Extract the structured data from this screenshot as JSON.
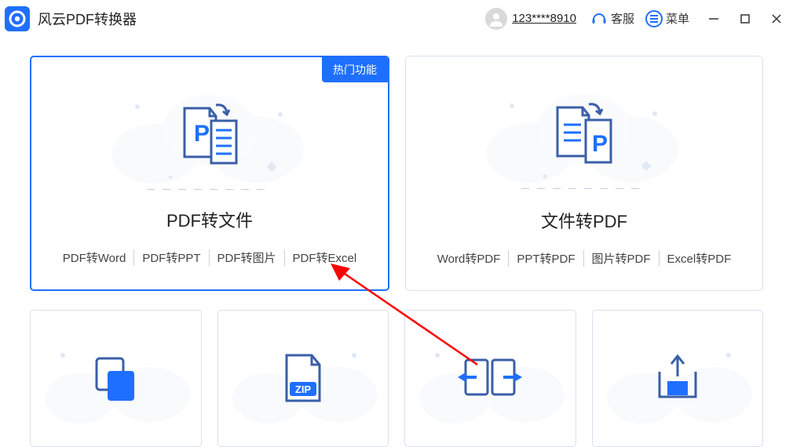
{
  "app": {
    "title": "风云PDF转换器"
  },
  "header": {
    "user_id": "123****8910",
    "service_label": "客服",
    "menu_label": "菜单"
  },
  "cards": {
    "hot_badge": "热门功能",
    "pdf_to_file": {
      "title": "PDF转文件",
      "subtypes": [
        "PDF转Word",
        "PDF转PPT",
        "PDF转图片",
        "PDF转Excel"
      ]
    },
    "file_to_pdf": {
      "title": "文件转PDF",
      "subtypes": [
        "Word转PDF",
        "PPT转PDF",
        "图片转PDF",
        "Excel转PDF"
      ]
    }
  },
  "small_cards": {
    "compress_zip_label": "ZIP"
  }
}
